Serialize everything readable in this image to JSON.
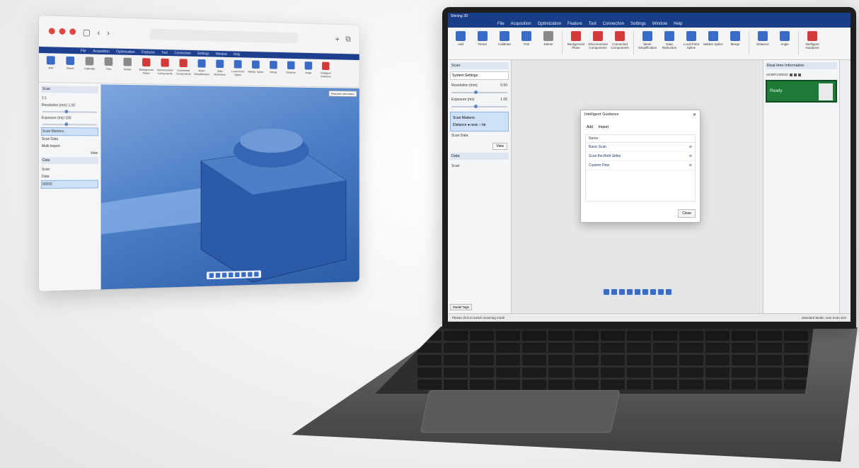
{
  "browser": {
    "menu": [
      "File",
      "Acquisition",
      "Optimization",
      "Features",
      "Tool",
      "Connection",
      "Settings",
      "Window",
      "Help"
    ],
    "ribbon": [
      "Add",
      "Reset",
      "Calibrate",
      "Trim",
      "Delete",
      "Background Plane",
      "Disconnected Components",
      "Connected Components",
      "Mesh Simplification",
      "Data Reduction",
      "Local Point Splice",
      "Marker Splice",
      "Merge",
      "Distance",
      "Angle",
      "Intelligent Guidance"
    ],
    "left": {
      "scan_header": "Scan",
      "select_value": "1:1",
      "resolution_label": "Resolution (mm)",
      "resolution_value": "1.00",
      "exposure_label": "Exposure (ms)",
      "exposure_value": "100",
      "scan_markers": "Scan Markers",
      "scan_data": "Scan Data",
      "multi_import": "Multi Import",
      "view_btn": "View",
      "data_header": "Data",
      "tree": [
        "Scan",
        "Data",
        "00000"
      ]
    },
    "viewport": {
      "badge": "Real-time Information"
    }
  },
  "laptop": {
    "title": "Shining 3D",
    "menu": [
      "File",
      "Acquisition",
      "Optimization",
      "Feature",
      "Tool",
      "Connection",
      "Settings",
      "Window",
      "Help"
    ],
    "ribbon": [
      "Add",
      "Reset",
      "Calibrate",
      "Trim",
      "Delete",
      "Background Plane",
      "Disconnected Components",
      "Connected Components",
      "Mesh Simplification",
      "Data Reduction",
      "Local Point Splice",
      "Marker Splice",
      "Merge",
      "Distance",
      "Angle",
      "Intelligent Guidance"
    ],
    "left": {
      "scan_header": "Scan",
      "system_settings": "System Settings",
      "resolution_label": "Resolution (mm)",
      "resolution_value": "0.50",
      "exposure_label": "Exposure (ms)",
      "exposure_value": "1.00",
      "scan_markers": "Scan Markers",
      "distance_label": "Distance",
      "near": "near",
      "far": "far",
      "scan_data": "Scan Data",
      "view_btn": "View",
      "data_header": "Data",
      "tree_item": "Scan",
      "tab": "Model Tags"
    },
    "dialog": {
      "title": "Intelligent Guidance",
      "tab_add": "Add",
      "tab_import": "Import",
      "list_header": "Name",
      "items": [
        "Basic Scan",
        "Scan the Both Sides",
        "Custom Flow"
      ]
    },
    "dialog_close": "Close",
    "right": {
      "header": "Real-time Information",
      "serial": "3X3DP1/00023",
      "status": "Ready"
    },
    "status_left": "Please click to switch scanning mode",
    "status_right": "Standard Mode: Auto   Scan size"
  },
  "colors": {
    "menubar": "#1a3d87",
    "accent": "#3a6cc7",
    "ready_green": "#1f7a3a",
    "dot_red": "#e0443e"
  }
}
